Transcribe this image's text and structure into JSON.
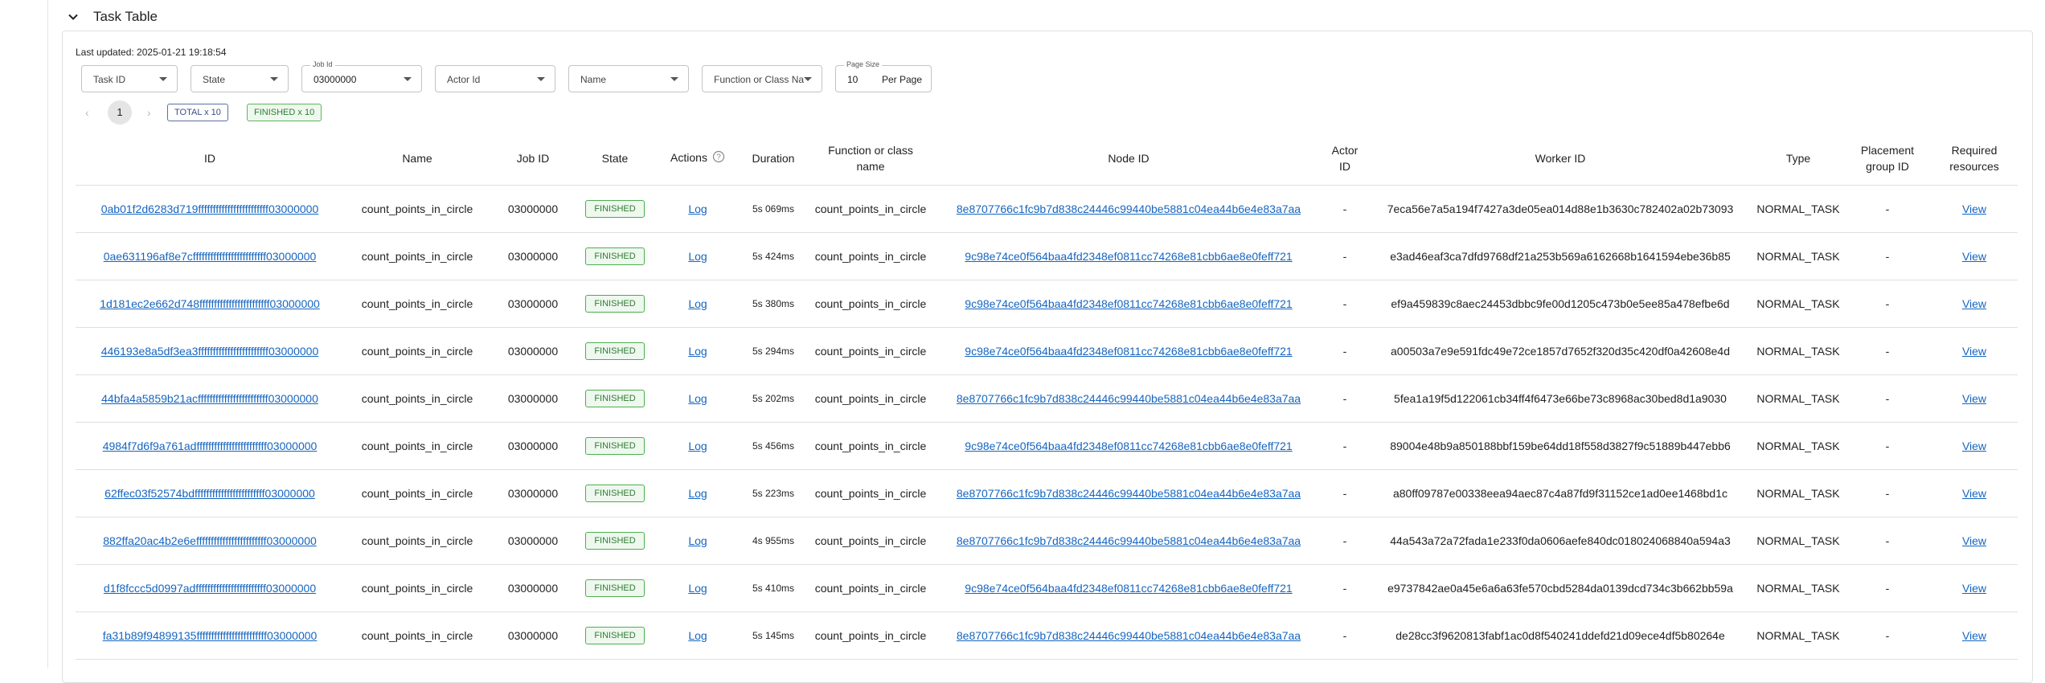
{
  "section": {
    "title": "Task Table"
  },
  "last_updated": "Last updated: 2025-01-21 19:18:54",
  "filters": {
    "task_id": "Task ID",
    "state": "State",
    "job_id_label": "Job Id",
    "job_id_value": "03000000",
    "actor_id": "Actor Id",
    "name": "Name",
    "function": "Function or Class Na",
    "page_size_label": "Page Size",
    "page_size_value": "10",
    "per_page": "Per Page"
  },
  "pagination": {
    "current": "1",
    "total_badge": "TOTAL x 10",
    "finished_badge": "FINISHED x 10"
  },
  "table": {
    "headers": {
      "id": "ID",
      "name": "Name",
      "job_id": "Job ID",
      "state": "State",
      "actions": "Actions",
      "duration": "Duration",
      "function_l1": "Function or class",
      "function_l2": "name",
      "node_id": "Node ID",
      "actor_l1": "Actor",
      "actor_l2": "ID",
      "worker_id": "Worker ID",
      "type": "Type",
      "placement_l1": "Placement",
      "placement_l2": "group ID",
      "required_l1": "Required",
      "required_l2": "resources"
    },
    "rows": [
      {
        "id": "0ab01f2d6283d719ffffffffffffffffffffffff03000000",
        "name": "count_points_in_circle",
        "job_id": "03000000",
        "state": "FINISHED",
        "action": "Log",
        "duration": "5s 069ms",
        "function": "count_points_in_circle",
        "node_id": "8e8707766c1fc9b7d838c24446c99440be5881c04ea44b6e4e83a7aa",
        "actor_id": "-",
        "worker_id": "7eca56e7a5a194f7427a3de05ea014d88e1b3630c782402a02b73093",
        "type": "NORMAL_TASK",
        "placement": "-",
        "resources": "View"
      },
      {
        "id": "0ae631196af8e7cfffffffffffffffffffffffff03000000",
        "name": "count_points_in_circle",
        "job_id": "03000000",
        "state": "FINISHED",
        "action": "Log",
        "duration": "5s 424ms",
        "function": "count_points_in_circle",
        "node_id": "9c98e74ce0f564baa4fd2348ef0811cc74268e81cbb6ae8e0feff721",
        "actor_id": "-",
        "worker_id": "e3ad46eaf3ca7dfd9768df21a253b569a6162668b1641594ebe36b85",
        "type": "NORMAL_TASK",
        "placement": "-",
        "resources": "View"
      },
      {
        "id": "1d181ec2e662d748ffffffffffffffffffffffff03000000",
        "name": "count_points_in_circle",
        "job_id": "03000000",
        "state": "FINISHED",
        "action": "Log",
        "duration": "5s 380ms",
        "function": "count_points_in_circle",
        "node_id": "9c98e74ce0f564baa4fd2348ef0811cc74268e81cbb6ae8e0feff721",
        "actor_id": "-",
        "worker_id": "ef9a459839c8aec24453dbbc9fe00d1205c473b0e5ee85a478efbe6d",
        "type": "NORMAL_TASK",
        "placement": "-",
        "resources": "View"
      },
      {
        "id": "446193e8a5df3ea3ffffffffffffffffffffffff03000000",
        "name": "count_points_in_circle",
        "job_id": "03000000",
        "state": "FINISHED",
        "action": "Log",
        "duration": "5s 294ms",
        "function": "count_points_in_circle",
        "node_id": "9c98e74ce0f564baa4fd2348ef0811cc74268e81cbb6ae8e0feff721",
        "actor_id": "-",
        "worker_id": "a00503a7e9e591fdc49e72ce1857d7652f320d35c420df0a42608e4d",
        "type": "NORMAL_TASK",
        "placement": "-",
        "resources": "View"
      },
      {
        "id": "44bfa4a5859b21acffffffffffffffffffffffff03000000",
        "name": "count_points_in_circle",
        "job_id": "03000000",
        "state": "FINISHED",
        "action": "Log",
        "duration": "5s 202ms",
        "function": "count_points_in_circle",
        "node_id": "8e8707766c1fc9b7d838c24446c99440be5881c04ea44b6e4e83a7aa",
        "actor_id": "-",
        "worker_id": "5fea1a19f5d122061cb34ff4f6473e66be73c8968ac30bed8d1a9030",
        "type": "NORMAL_TASK",
        "placement": "-",
        "resources": "View"
      },
      {
        "id": "4984f7d6f9a761adffffffffffffffffffffffff03000000",
        "name": "count_points_in_circle",
        "job_id": "03000000",
        "state": "FINISHED",
        "action": "Log",
        "duration": "5s 456ms",
        "function": "count_points_in_circle",
        "node_id": "9c98e74ce0f564baa4fd2348ef0811cc74268e81cbb6ae8e0feff721",
        "actor_id": "-",
        "worker_id": "89004e48b9a850188bbf159be64dd18f558d3827f9c51889b447ebb6",
        "type": "NORMAL_TASK",
        "placement": "-",
        "resources": "View"
      },
      {
        "id": "62ffec03f52574bdffffffffffffffffffffffff03000000",
        "name": "count_points_in_circle",
        "job_id": "03000000",
        "state": "FINISHED",
        "action": "Log",
        "duration": "5s 223ms",
        "function": "count_points_in_circle",
        "node_id": "8e8707766c1fc9b7d838c24446c99440be5881c04ea44b6e4e83a7aa",
        "actor_id": "-",
        "worker_id": "a80ff09787e00338eea94aec87c4a87fd9f31152ce1ad0ee1468bd1c",
        "type": "NORMAL_TASK",
        "placement": "-",
        "resources": "View"
      },
      {
        "id": "882ffa20ac4b2e6effffffffffffffffffffffff03000000",
        "name": "count_points_in_circle",
        "job_id": "03000000",
        "state": "FINISHED",
        "action": "Log",
        "duration": "4s 955ms",
        "function": "count_points_in_circle",
        "node_id": "8e8707766c1fc9b7d838c24446c99440be5881c04ea44b6e4e83a7aa",
        "actor_id": "-",
        "worker_id": "44a543a72a72fada1e233f0da0606aefe840dc018024068840a594a3",
        "type": "NORMAL_TASK",
        "placement": "-",
        "resources": "View"
      },
      {
        "id": "d1f8fccc5d0997adffffffffffffffffffffffff03000000",
        "name": "count_points_in_circle",
        "job_id": "03000000",
        "state": "FINISHED",
        "action": "Log",
        "duration": "5s 410ms",
        "function": "count_points_in_circle",
        "node_id": "9c98e74ce0f564baa4fd2348ef0811cc74268e81cbb6ae8e0feff721",
        "actor_id": "-",
        "worker_id": "e9737842ae0a45e6a6a63fe570cbd5284da0139dcd734c3b662bb59a",
        "type": "NORMAL_TASK",
        "placement": "-",
        "resources": "View"
      },
      {
        "id": "fa31b89f94899135ffffffffffffffffffffffff03000000",
        "name": "count_points_in_circle",
        "job_id": "03000000",
        "state": "FINISHED",
        "action": "Log",
        "duration": "5s 145ms",
        "function": "count_points_in_circle",
        "node_id": "8e8707766c1fc9b7d838c24446c99440be5881c04ea44b6e4e83a7aa",
        "actor_id": "-",
        "worker_id": "de28cc3f9620813fabf1ac0d8f540241ddefd21d09ece4df5b80264e",
        "type": "NORMAL_TASK",
        "placement": "-",
        "resources": "View"
      }
    ]
  }
}
